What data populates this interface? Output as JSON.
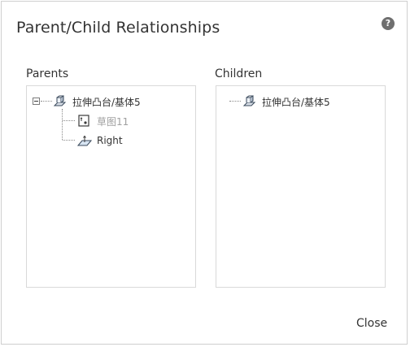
{
  "dialog": {
    "title": "Parent/Child Relationships",
    "help_icon": "question-circle-icon",
    "help_glyph": "?",
    "close_label": "Close"
  },
  "parents": {
    "label": "Parents",
    "root": {
      "label": "拉伸凸台/基体5",
      "icon": "extrude-feature-icon",
      "expanded": true,
      "children": [
        {
          "label": "草图11",
          "icon": "sketch-icon",
          "muted": true
        },
        {
          "label": "Right",
          "icon": "plane-icon",
          "muted": false
        }
      ]
    }
  },
  "children": {
    "label": "Children",
    "items": [
      {
        "label": "拉伸凸台/基体5",
        "icon": "extrude-feature-icon"
      }
    ]
  }
}
